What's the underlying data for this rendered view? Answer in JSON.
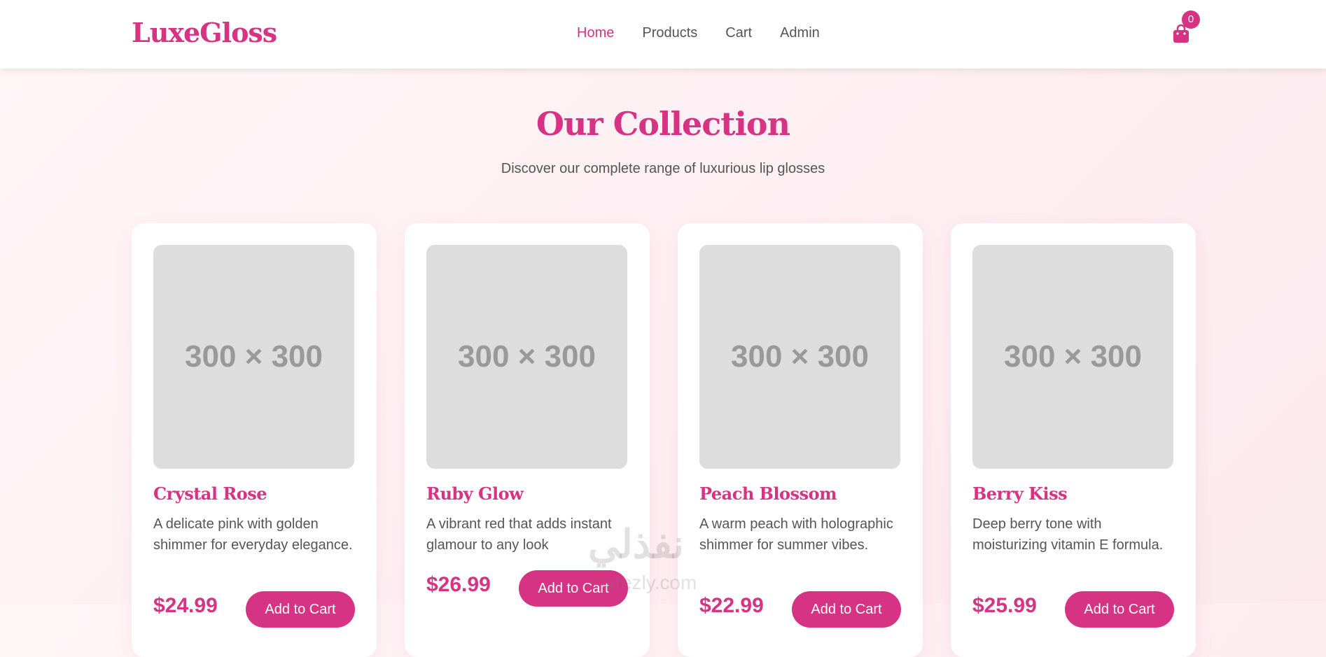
{
  "brand": {
    "name": "LuxeGloss"
  },
  "nav": {
    "links": [
      {
        "label": "Home",
        "active": true
      },
      {
        "label": "Products",
        "active": false
      },
      {
        "label": "Cart",
        "active": false
      },
      {
        "label": "Admin",
        "active": false
      }
    ],
    "cart_icon": "shopping-bag-icon",
    "cart_count": "0"
  },
  "collection": {
    "title": "Our Collection",
    "subtitle": "Discover our complete range of luxurious lip glosses"
  },
  "products": [
    {
      "image_label": "300 × 300",
      "name": "Crystal Rose",
      "description": "A delicate pink with golden shimmer for everyday elegance.",
      "price": "$24.99",
      "button": "Add to Cart"
    },
    {
      "image_label": "300 × 300",
      "name": "Ruby Glow",
      "description": "A vibrant red that adds instant glamour to any look",
      "price": "$26.99",
      "button": "Add to Cart"
    },
    {
      "image_label": "300 × 300",
      "name": "Peach Blossom",
      "description": "A warm peach with holographic shimmer for summer vibes.",
      "price": "$22.99",
      "button": "Add to Cart"
    },
    {
      "image_label": "300 × 300",
      "name": "Berry Kiss",
      "description": "Deep berry tone with moisturizing vitamin E formula.",
      "price": "$25.99",
      "button": "Add to Cart"
    }
  ],
  "watermark": {
    "logo": "نفذلي",
    "domain": "nafezly.com"
  },
  "colors": {
    "accent": "#d63384",
    "text": "#555555",
    "placeholder_bg": "#dddddd",
    "placeholder_text": "#999999"
  }
}
